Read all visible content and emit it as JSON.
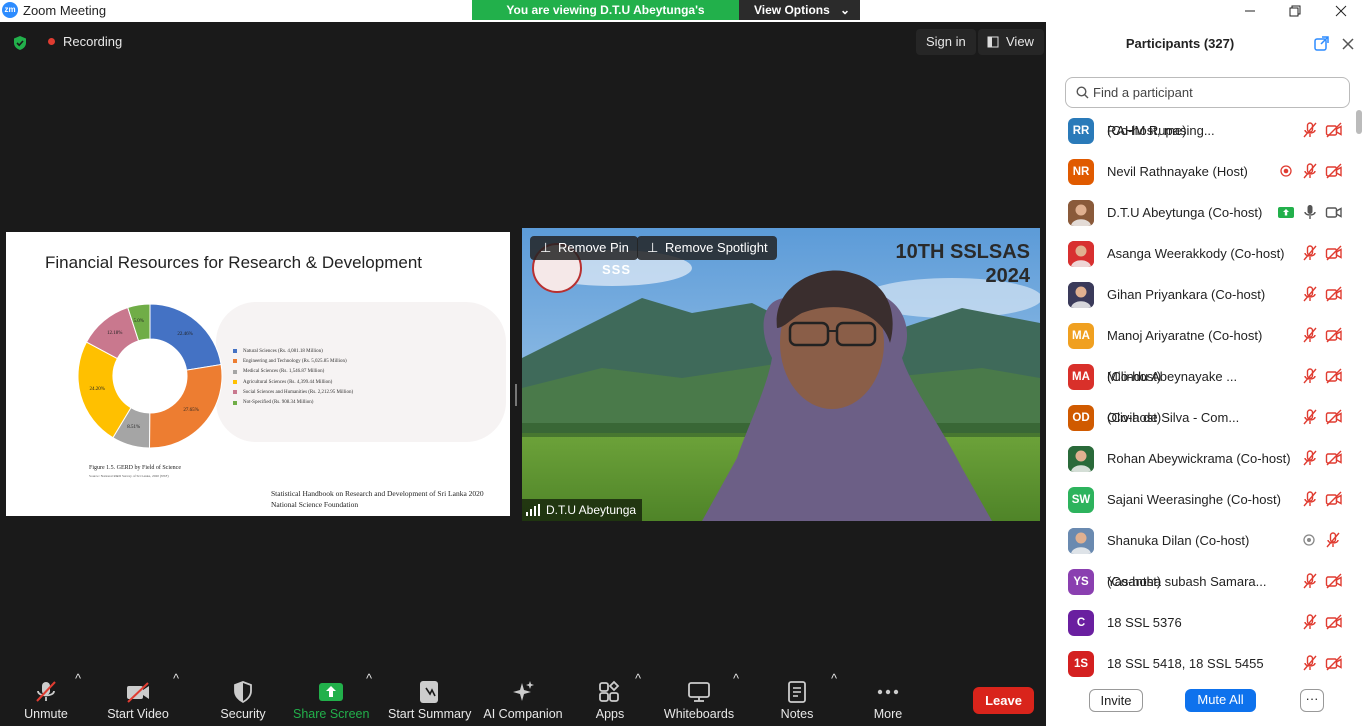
{
  "window": {
    "app_icon": "zm",
    "title": "Zoom Meeting",
    "minimize_icon": "minimize-icon",
    "maximize_icon": "restore-icon",
    "close_icon": "close-icon"
  },
  "banner": {
    "message": "You are viewing D.T.U Abeytunga's screen",
    "options_label": "View Options"
  },
  "meeting_top": {
    "recording_label": "Recording",
    "sign_in_label": "Sign in",
    "view_label": "View"
  },
  "slide": {
    "title": "Financial Resources for Research & Development",
    "figure_caption": "Figure 1.5. GERD by Field of Science",
    "figure_source": "Source: National R&D Survey of Sri Lanka, 2020 (NSF)",
    "footer_line1": "Statistical Handbook on Research and Development of Sri Lanka 2020",
    "footer_line2": "National Science Foundation"
  },
  "chart_data": {
    "type": "pie",
    "style": "donut",
    "series": [
      {
        "name": "Natural Sciences (Rs. 4,081.18 Million)",
        "value": 22.46,
        "label": "22.46%",
        "color": "#4472c4"
      },
      {
        "name": "Engineering and Technology (Rs. 5,025.85 Million)",
        "value": 27.65,
        "label": "27.65%",
        "color": "#ed7d31"
      },
      {
        "name": "Medical Sciences (Rs. 1,546.87 Million)",
        "value": 8.51,
        "label": "8.51%",
        "color": "#a5a5a5"
      },
      {
        "name": "Agricultural Sciences (Rs. 4,399.44 Million)",
        "value": 24.2,
        "label": "24.20%",
        "color": "#ffc000"
      },
      {
        "name": "Social Sciences and Humanities (Rs. 2,212.95 Million)",
        "value": 12.18,
        "label": "12.18%",
        "color": "#c9788e"
      },
      {
        "name": "Not-Specified (Rs. 908.34 Million)",
        "value": 5.0,
        "label": "5.0%",
        "color": "#70ad47"
      }
    ],
    "legend_position": "right"
  },
  "video": {
    "remove_pin_label": "Remove Pin",
    "remove_spotlight_label": "Remove Spotlight",
    "overlay_title_line1": "10TH SSLSAS",
    "overlay_title_line2": "2024",
    "overlay_logo_text": "SSS",
    "participant_name": "D.T.U Abeytunga"
  },
  "toolbar": {
    "unmute": "Unmute",
    "start_video": "Start Video",
    "security": "Security",
    "share_screen": "Share Screen",
    "start_summary": "Start Summary",
    "ai_companion": "AI Companion",
    "apps": "Apps",
    "whiteboards": "Whiteboards",
    "notes": "Notes",
    "more": "More",
    "leave": "Leave",
    "accent_green": "#22b04b",
    "leave_color": "#d9241b"
  },
  "participants": {
    "header": "Participants (327)",
    "search_placeholder": "Find a participant",
    "invite_label": "Invite",
    "mute_all_label": "Mute All",
    "more_label": "···",
    "list": [
      {
        "initials": "RR",
        "name": "RAHM Rupasing...",
        "role": "(Co-host, me)",
        "color": "#2a7ab9",
        "mic": "muted",
        "video": "off"
      },
      {
        "initials": "NR",
        "name": "Nevil Rathnayake (Host)",
        "role": "",
        "color": "#e05a00",
        "mic": "muted",
        "video": "off",
        "recording": true
      },
      {
        "initials": "",
        "name": "D.T.U Abeytunga (Co-host)",
        "role": "",
        "color": "#8a5a3a",
        "mic": "on",
        "video": "on",
        "sharing": true,
        "photo": true
      },
      {
        "initials": "",
        "name": "Asanga Weerakkody (Co-host)",
        "role": "",
        "color": "#d83030",
        "mic": "muted",
        "video": "off",
        "photo": true
      },
      {
        "initials": "",
        "name": "Gihan Priyankara (Co-host)",
        "role": "",
        "color": "#3a3a5a",
        "mic": "muted",
        "video": "off",
        "photo": true
      },
      {
        "initials": "MA",
        "name": "Manoj Ariyaratne (Co-host)",
        "role": "",
        "color": "#f0a020",
        "mic": "muted",
        "video": "off"
      },
      {
        "initials": "MA",
        "name": "Milindu Abeynayake ...",
        "role": "(Co-host)",
        "color": "#d9302a",
        "mic": "muted",
        "video": "off"
      },
      {
        "initials": "OD",
        "name": "Olivia de Silva - Com...",
        "role": "(Co-host)",
        "color": "#d05a00",
        "mic": "muted",
        "video": "off"
      },
      {
        "initials": "",
        "name": "Rohan Abeywickrama (Co-host)",
        "role": "",
        "color": "#2a6a3a",
        "mic": "muted",
        "video": "off",
        "photo": true
      },
      {
        "initials": "SW",
        "name": "Sajani Weerasinghe (Co-host)",
        "role": "",
        "color": "#2db35d",
        "mic": "muted",
        "video": "off"
      },
      {
        "initials": "",
        "name": "Shanuka Dilan (Co-host)",
        "role": "",
        "color": "#6a8ab0",
        "mic": "muted",
        "video": "none",
        "recording_outline": true,
        "photo": true
      },
      {
        "initials": "YS",
        "name": "Yasantha subash Samara...",
        "role": "(Co-host)",
        "color": "#8a3fb0",
        "mic": "muted",
        "video": "off"
      },
      {
        "initials": "C",
        "name": "18 SSL 5376",
        "role": "",
        "color": "#6a1fa0",
        "mic": "muted",
        "video": "off"
      },
      {
        "initials": "1S",
        "name": "18 SSL 5418, 18 SSL 5455",
        "role": "",
        "color": "#d42020",
        "mic": "muted",
        "video": "off"
      }
    ]
  }
}
